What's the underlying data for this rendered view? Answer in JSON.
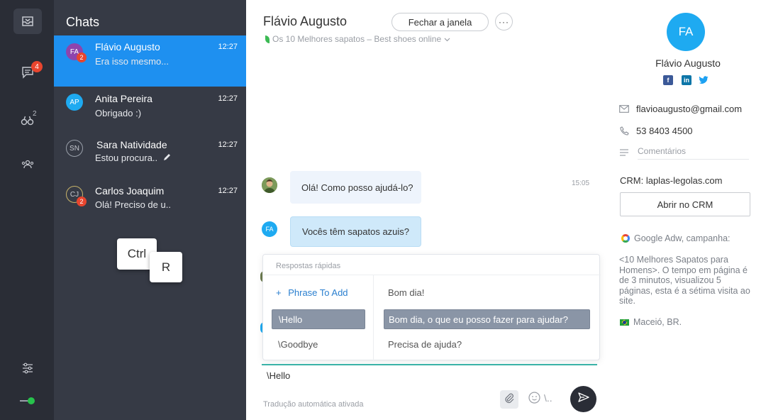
{
  "rail": {
    "chat_badge": "4",
    "contacts_sup": "2",
    "status_color": "#27c24c"
  },
  "chatlist": {
    "title": "Chats",
    "items": [
      {
        "initials": "FA",
        "name": "Flávio Augusto",
        "time": "12:27",
        "preview": "Era isso mesmo...",
        "badge": "2",
        "avatar_color": "#8e44ad"
      },
      {
        "initials": "AP",
        "name": "Anita Pereira",
        "time": "12:27",
        "preview": "Obrigado :)",
        "badge": "",
        "avatar_color": "#1eaaf1"
      },
      {
        "initials": "SN",
        "name": "Sara Natividade",
        "time": "12:27",
        "preview": "Estou procura..",
        "badge": "",
        "avatar_color": "outline"
      },
      {
        "initials": "CJ",
        "name": "Carlos Joaquim",
        "time": "12:27",
        "preview": "Olá! Preciso de u..",
        "badge": "2",
        "avatar_color": "outline"
      }
    ]
  },
  "keys": {
    "ctrl": "Ctrl",
    "r": "R"
  },
  "header": {
    "contact_name": "Flávio Augusto",
    "close_button": "Fechar a janela",
    "more_button": "···",
    "campaign": "Os 10 Melhores sapatos – Best shoes online"
  },
  "messages": [
    {
      "from": "agent",
      "text": "Olá! Como posso ajudá-lo?",
      "time": "15:05"
    },
    {
      "from": "client",
      "initials": "FA",
      "text": "Vocês têm sapatos azuis?"
    }
  ],
  "quick_replies": {
    "title": "Respostas rápidas",
    "add_label": "Phrase To Add",
    "shortcuts": [
      "\\Hello",
      "\\Goodbye"
    ],
    "selected_shortcut": "\\Hello",
    "texts": [
      "Bom dia!",
      "Bom dia, o que eu posso fazer para ajudar?",
      "Precisa de ajuda?"
    ],
    "selected_text": "Bom dia, o que eu posso fazer para ajudar?"
  },
  "composer": {
    "value": "\\Hello",
    "translation_note": "Tradução automática ativada",
    "slash_hint": "\\.."
  },
  "profile": {
    "initials": "FA",
    "name": "Flávio Augusto",
    "email": "flavioaugusto@gmail.com",
    "phone": "53 8403 4500",
    "comments_placeholder": "Comentários",
    "crm_label": "CRM: laplas-legolas.com",
    "crm_button": "Abrir no CRM",
    "adwords": "Google Adw, campanha:",
    "adwords_desc": "<10 Melhores Sapatos para Homens>. O tempo em página é de 3 minutos, visualizou 5 páginas, esta é a sétima visita ao site.",
    "location": "Maceió, BR."
  },
  "colors": {
    "accent": "#1e90f0",
    "rail": "#2a2d36",
    "chatlist": "#363a45",
    "badge": "#e8452e",
    "client_bubble": "#cfe9fa",
    "agent_bubble": "#eef4fc"
  }
}
